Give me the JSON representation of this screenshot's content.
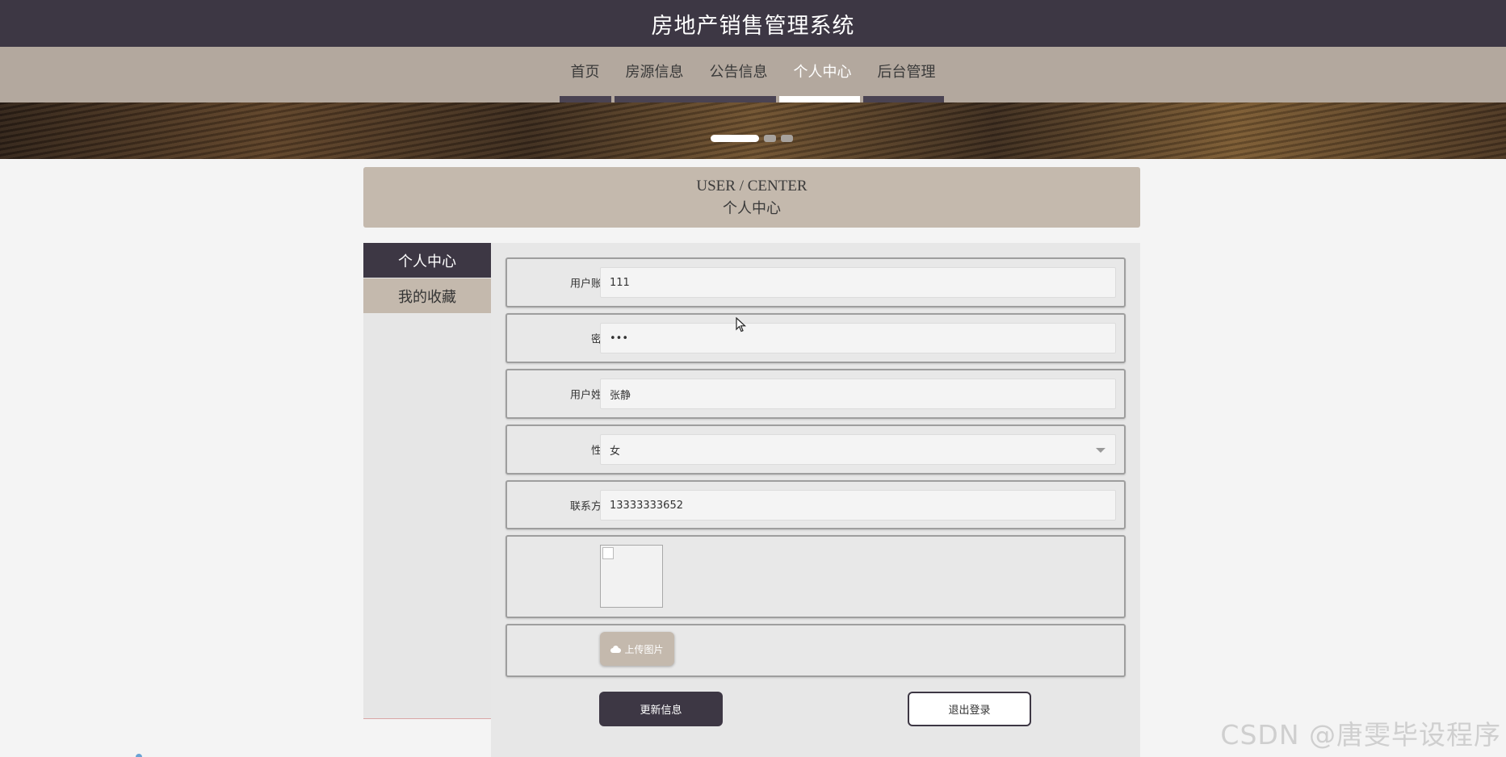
{
  "app": {
    "title": "房地产销售管理系统"
  },
  "nav": {
    "items": [
      {
        "label": "首页",
        "active": false
      },
      {
        "label": "房源信息",
        "active": false
      },
      {
        "label": "公告信息",
        "active": false
      },
      {
        "label": "个人中心",
        "active": true
      },
      {
        "label": "后台管理",
        "active": false
      }
    ]
  },
  "carousel": {
    "slides": 3,
    "active_index": 0
  },
  "section": {
    "en_title": "USER / CENTER",
    "cn_title": "个人中心"
  },
  "sidebar": {
    "items": [
      {
        "label": "个人中心",
        "active": true
      },
      {
        "label": "我的收藏",
        "active": false
      }
    ]
  },
  "form": {
    "account": {
      "label": "用户账号",
      "value": "111"
    },
    "password": {
      "label": "密码",
      "value": "•••"
    },
    "name": {
      "label": "用户姓名",
      "value": "张静"
    },
    "gender": {
      "label": "性别",
      "value": "女"
    },
    "phone": {
      "label": "联系方式",
      "value": "13333333652"
    },
    "upload_label": "上传图片",
    "update_button": "更新信息",
    "logout_button": "退出登录"
  },
  "watermark": "CSDN @唐雯毕设程序",
  "colors": {
    "header": "#3d3744",
    "nav": "#b3a89e",
    "accent": "#c4b9ad"
  }
}
